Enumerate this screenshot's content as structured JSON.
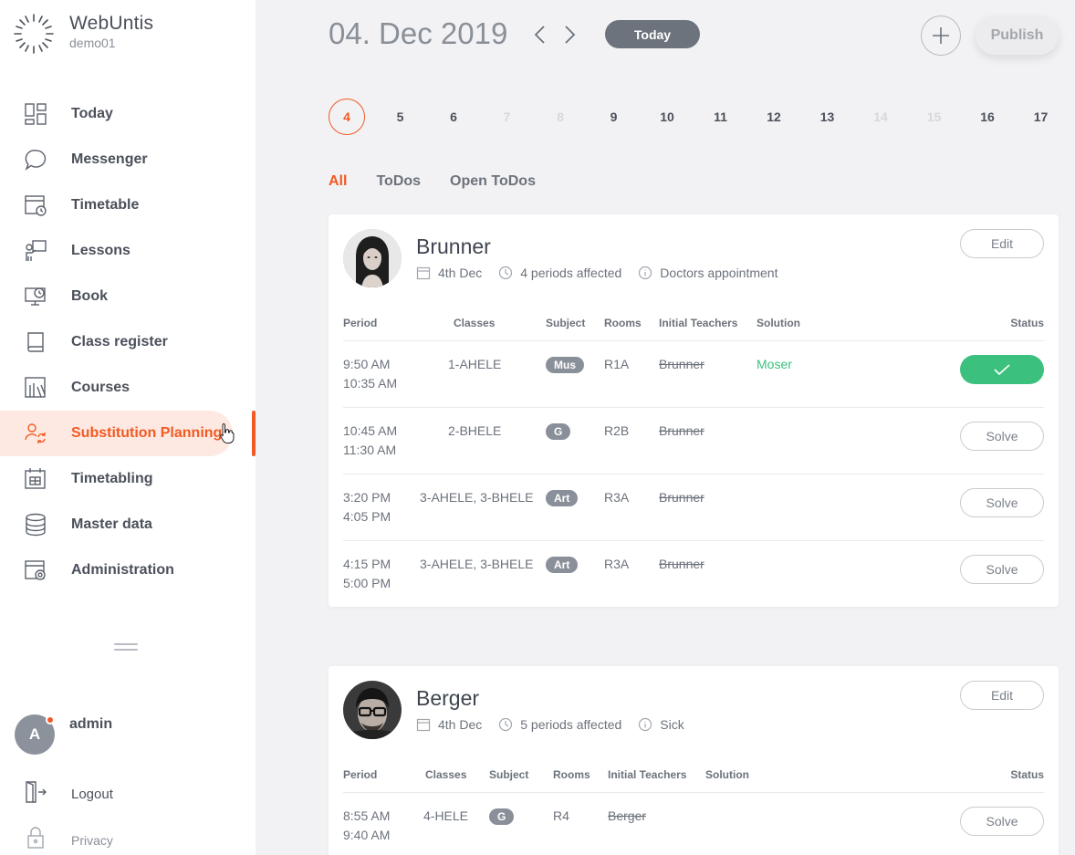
{
  "app": {
    "name": "WebUntis",
    "school": "demo01"
  },
  "colors": {
    "accent": "#f15a24",
    "success": "#3cc07d",
    "badge": "#8a9099"
  },
  "nav": [
    {
      "label": "Today",
      "icon": "dashboard-icon"
    },
    {
      "label": "Messenger",
      "icon": "chat-bubble-icon"
    },
    {
      "label": "Timetable",
      "icon": "calendar-clock-icon"
    },
    {
      "label": "Lessons",
      "icon": "teacher-board-icon"
    },
    {
      "label": "Book",
      "icon": "monitor-clock-icon"
    },
    {
      "label": "Class register",
      "icon": "book-icon"
    },
    {
      "label": "Courses",
      "icon": "books-shelf-icon"
    },
    {
      "label": "Substitution Planning",
      "icon": "user-swap-icon",
      "active": true
    },
    {
      "label": "Timetabling",
      "icon": "calendar-grid-icon"
    },
    {
      "label": "Master data",
      "icon": "database-icon"
    },
    {
      "label": "Administration",
      "icon": "calendar-gear-icon"
    }
  ],
  "user": {
    "initial": "A",
    "name": "admin"
  },
  "logout": "Logout",
  "privacy": "Privacy",
  "header": {
    "date": "04. Dec 2019",
    "today_label": "Today",
    "publish_label": "Publish"
  },
  "days": [
    {
      "label": "4",
      "state": "selected"
    },
    {
      "label": "5",
      "state": "normal"
    },
    {
      "label": "6",
      "state": "normal"
    },
    {
      "label": "7",
      "state": "dim"
    },
    {
      "label": "8",
      "state": "dim"
    },
    {
      "label": "9",
      "state": "normal"
    },
    {
      "label": "10",
      "state": "normal"
    },
    {
      "label": "11",
      "state": "normal"
    },
    {
      "label": "12",
      "state": "normal"
    },
    {
      "label": "13",
      "state": "normal"
    },
    {
      "label": "14",
      "state": "dim"
    },
    {
      "label": "15",
      "state": "dim"
    },
    {
      "label": "16",
      "state": "normal"
    },
    {
      "label": "17",
      "state": "normal"
    }
  ],
  "filters": {
    "all": "All",
    "todos": "ToDos",
    "open_todos": "Open ToDos"
  },
  "columns": {
    "period": "Period",
    "classes": "Classes",
    "subject": "Subject",
    "rooms": "Rooms",
    "initial": "Initial Teachers",
    "solution": "Solution",
    "status": "Status"
  },
  "absences": [
    {
      "name": "Brunner",
      "date": "4th Dec",
      "periods": "4 periods affected",
      "reason": "Doctors appointment",
      "edit_label": "Edit",
      "rows": [
        {
          "start": "9:50 AM",
          "end": "10:35 AM",
          "classes": "1-AHELE",
          "subject": "Mus",
          "room": "R1A",
          "teacher": "Brunner",
          "solution": "Moser",
          "status": "solved"
        },
        {
          "start": "10:45 AM",
          "end": "11:30 AM",
          "classes": "2-BHELE",
          "subject": "G",
          "room": "R2B",
          "teacher": "Brunner",
          "solution": "",
          "status": "Solve"
        },
        {
          "start": "3:20 PM",
          "end": "4:05 PM",
          "classes": "3-AHELE, 3-BHELE",
          "subject": "Art",
          "room": "R3A",
          "teacher": "Brunner",
          "solution": "",
          "status": "Solve"
        },
        {
          "start": "4:15 PM",
          "end": "5:00 PM",
          "classes": "3-AHELE, 3-BHELE",
          "subject": "Art",
          "room": "R3A",
          "teacher": "Brunner",
          "solution": "",
          "status": "Solve"
        }
      ]
    },
    {
      "name": "Berger",
      "date": "4th Dec",
      "periods": "5 periods affected",
      "reason": "Sick",
      "edit_label": "Edit",
      "rows": [
        {
          "start": "8:55 AM",
          "end": "9:40 AM",
          "classes": "4-HELE",
          "subject": "G",
          "room": "R4",
          "teacher": "Berger",
          "solution": "",
          "status": "Solve"
        }
      ]
    }
  ]
}
